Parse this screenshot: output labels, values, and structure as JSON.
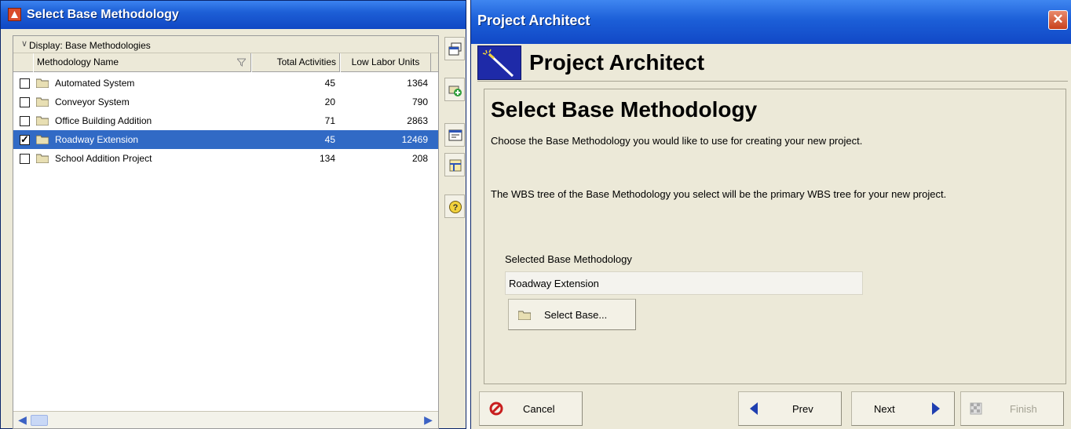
{
  "left_window": {
    "title": "Select Base Methodology",
    "display_label": "Display: Base Methodologies",
    "columns": {
      "name": "Methodology Name",
      "total": "Total Activities",
      "low": "Low Labor Units"
    },
    "rows": [
      {
        "name": "Automated System",
        "total": "45",
        "low": "1364",
        "checked": false,
        "selected": false
      },
      {
        "name": "Conveyor System",
        "total": "20",
        "low": "790",
        "checked": false,
        "selected": false
      },
      {
        "name": "Office Building Addition",
        "total": "71",
        "low": "2863",
        "checked": false,
        "selected": false
      },
      {
        "name": "Roadway Extension",
        "total": "45",
        "low": "12469",
        "checked": true,
        "selected": true
      },
      {
        "name": "School Addition Project",
        "total": "134",
        "low": "208",
        "checked": false,
        "selected": false
      }
    ],
    "toolbar_icons": [
      "open-window-icon",
      "add-icon",
      "properties-icon",
      "layout-icon",
      "help-icon"
    ]
  },
  "right_window": {
    "title": "Project Architect",
    "header_title": "Project Architect",
    "step_title": "Select Base Methodology",
    "desc1": "Choose the Base Methodology you would like to use for creating your new project.",
    "desc2": "The WBS tree of the Base Methodology you select will be the primary WBS tree for your new project.",
    "selected_label": "Selected Base Methodology",
    "selected_value": "Roadway Extension",
    "select_base_label": "Select Base...",
    "buttons": {
      "cancel": "Cancel",
      "prev": "Prev",
      "next": "Next",
      "finish": "Finish"
    }
  },
  "colors": {
    "titlebar": "#1d5fd6",
    "selection": "#316ac5",
    "panel": "#ece9d8"
  }
}
